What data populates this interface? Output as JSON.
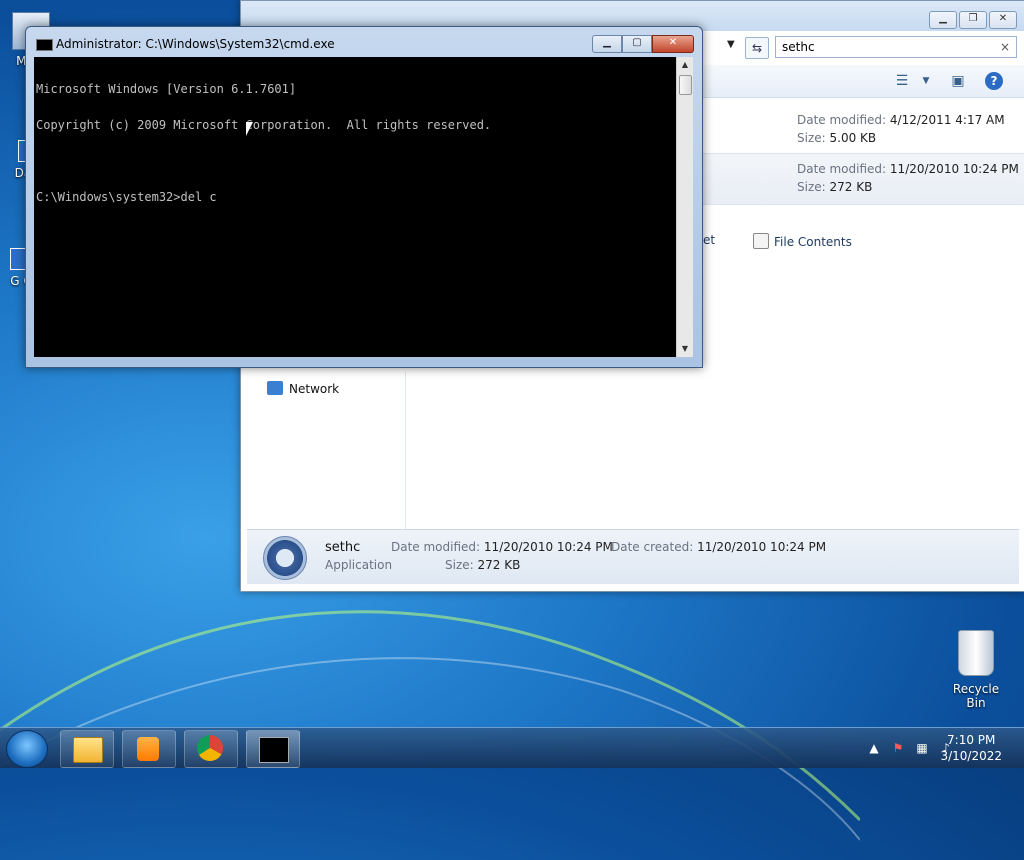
{
  "desktop": {
    "icons": [
      {
        "label": "My C"
      },
      {
        "label": "Data"
      },
      {
        "label": "G C"
      }
    ],
    "recycle_bin": {
      "label": "Recycle Bin"
    }
  },
  "explorer": {
    "search": {
      "value": "sethc",
      "clear_glyph": "×"
    },
    "results": [
      {
        "date_label": "Date modified:",
        "date_value": "4/12/2011 4:17 AM",
        "size_label": "Size:",
        "size_value": "5.00 KB"
      },
      {
        "date_label": "Date modified:",
        "date_value": "11/20/2010 10:24 PM",
        "size_label": "Size:",
        "size_value": "272 KB"
      }
    ],
    "search_again": {
      "internet": "nternet",
      "file_contents": "File Contents"
    },
    "nav": {
      "network": "Network"
    },
    "details": {
      "name": "sethc",
      "type": "Application",
      "modified_label": "Date modified:",
      "modified_value": "11/20/2010 10:24 PM",
      "created_label": "Date created:",
      "created_value": "11/20/2010 10:24 PM",
      "size_label": "Size:",
      "size_value": "272 KB"
    }
  },
  "cmd": {
    "title": "Administrator: C:\\Windows\\System32\\cmd.exe",
    "lines": [
      "Microsoft Windows [Version 6.1.7601]",
      "Copyright (c) 2009 Microsoft Corporation.  All rights reserved.",
      "",
      "C:\\Windows\\system32>del c"
    ]
  },
  "taskbar": {
    "clock": {
      "time": "7:10 PM",
      "date": "3/10/2022"
    }
  },
  "colors": {
    "desktop": "#1e78c8",
    "console_bg": "#000000",
    "console_fg": "#c0c0c0"
  }
}
